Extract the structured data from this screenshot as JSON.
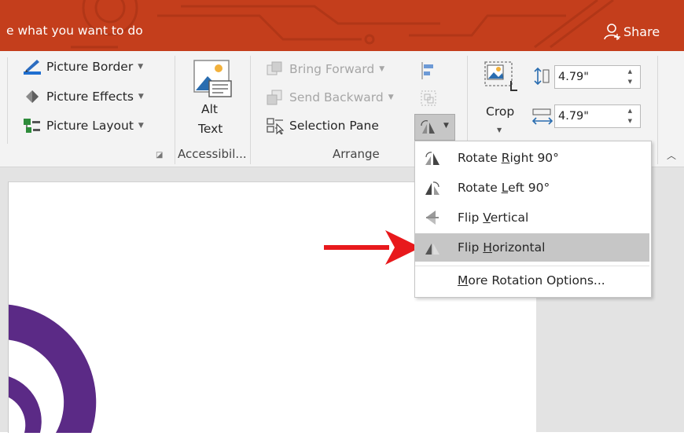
{
  "titlebar": {
    "tell_me": "e what you want to do",
    "share": "Share",
    "color": "#c43e1c"
  },
  "ribbon": {
    "picture_border": "Picture Border",
    "picture_effects": "Picture Effects",
    "picture_layout": "Picture Layout",
    "alt_text_line1": "Alt",
    "alt_text_line2": "Text",
    "accessibility_group": "Accessibil...",
    "bring_forward": "Bring Forward",
    "send_backward": "Send Backward",
    "selection_pane": "Selection Pane",
    "arrange_group": "Arrange",
    "crop": "Crop",
    "height_value": "4.79\"",
    "width_value": "4.79\""
  },
  "rotate_menu": {
    "items": [
      {
        "pre": "Rotate ",
        "key": "R",
        "post": "ight 90°",
        "icon": "rotate-right-icon"
      },
      {
        "pre": "Rotate ",
        "key": "L",
        "post": "eft 90°",
        "icon": "rotate-left-icon"
      },
      {
        "pre": "Flip ",
        "key": "V",
        "post": "ertical",
        "icon": "flip-vertical-icon"
      },
      {
        "pre": "Flip ",
        "key": "H",
        "post": "orizontal",
        "icon": "flip-horizontal-icon"
      },
      {
        "pre": "",
        "key": "M",
        "post": "ore Rotation Options...",
        "icon": ""
      }
    ],
    "highlighted_item": "Flip Horizontal"
  },
  "colors": {
    "accent_arrow": "#e8191c",
    "slide_shape": "#5b2a86",
    "menu_highlight": "#c6c6c6"
  }
}
